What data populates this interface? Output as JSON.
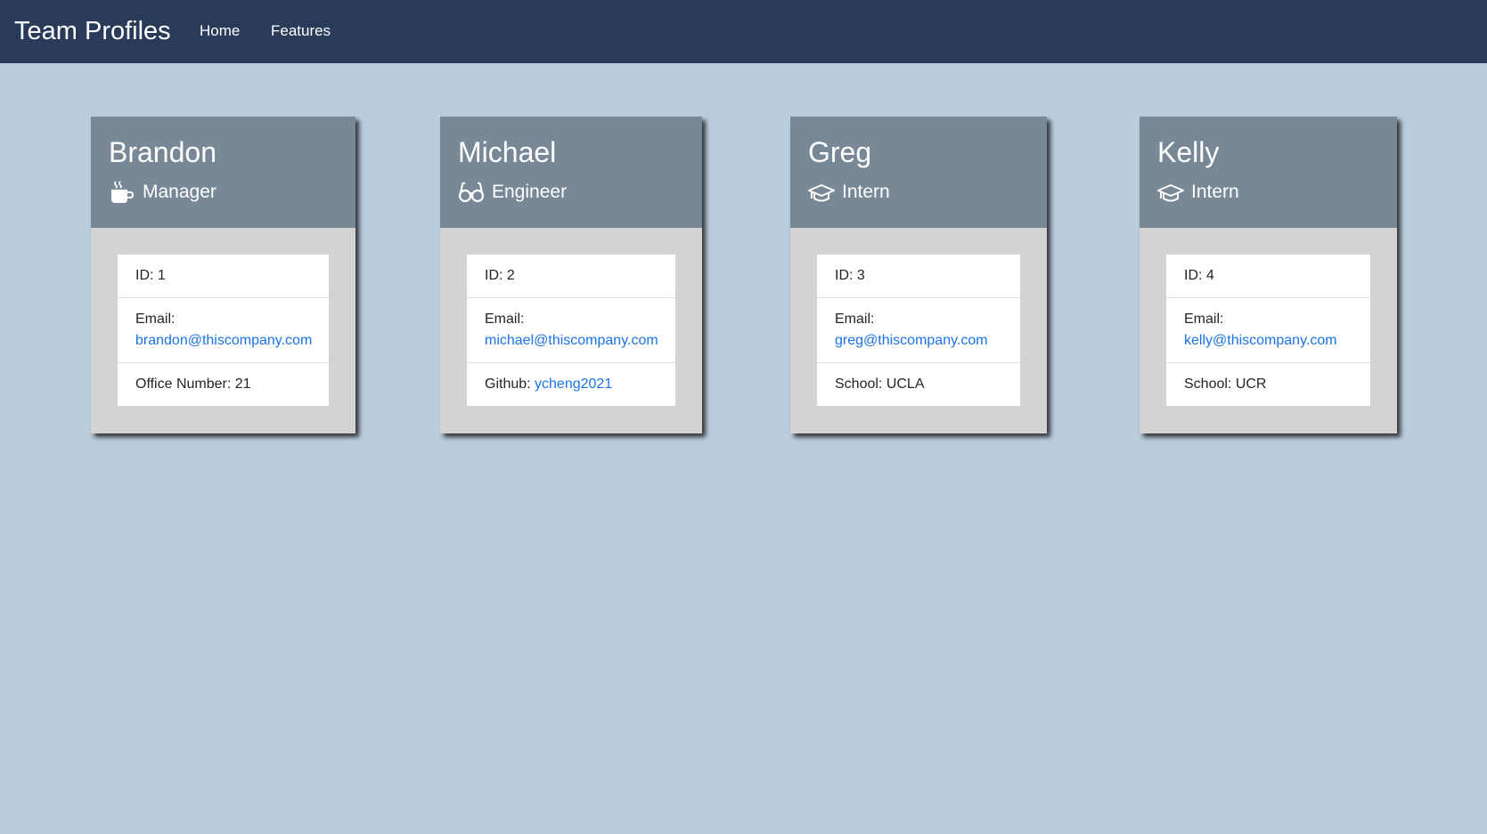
{
  "navbar": {
    "brand": "Team Profiles",
    "links": [
      "Home",
      "Features"
    ]
  },
  "colors": {
    "navbar_bg": "#293b59",
    "page_bg": "#bacdde",
    "card_header_bg": "#788897",
    "card_body_bg": "#d3d3d3",
    "link": "#1a73e8"
  },
  "cards": [
    {
      "name": "Brandon",
      "role": "Manager",
      "role_icon": "mug-icon",
      "id_text": "ID: 1",
      "email_label": "Email:",
      "email": "brandon@thiscompany.com",
      "extra_label": "Office Number: 21",
      "extra_value": ""
    },
    {
      "name": "Michael",
      "role": "Engineer",
      "role_icon": "glasses-icon",
      "id_text": "ID: 2",
      "email_label": "Email:",
      "email": "michael@thiscompany.com",
      "extra_label": "Github: ",
      "extra_value": "ycheng2021"
    },
    {
      "name": "Greg",
      "role": "Intern",
      "role_icon": "graduation-cap-icon",
      "id_text": "ID: 3",
      "email_label": "Email:",
      "email": "greg@thiscompany.com",
      "extra_label": "School: UCLA",
      "extra_value": ""
    },
    {
      "name": "Kelly",
      "role": "Intern",
      "role_icon": "graduation-cap-icon",
      "id_text": "ID: 4",
      "email_label": "Email:",
      "email": "kelly@thiscompany.com",
      "extra_label": "School: UCR",
      "extra_value": ""
    }
  ]
}
